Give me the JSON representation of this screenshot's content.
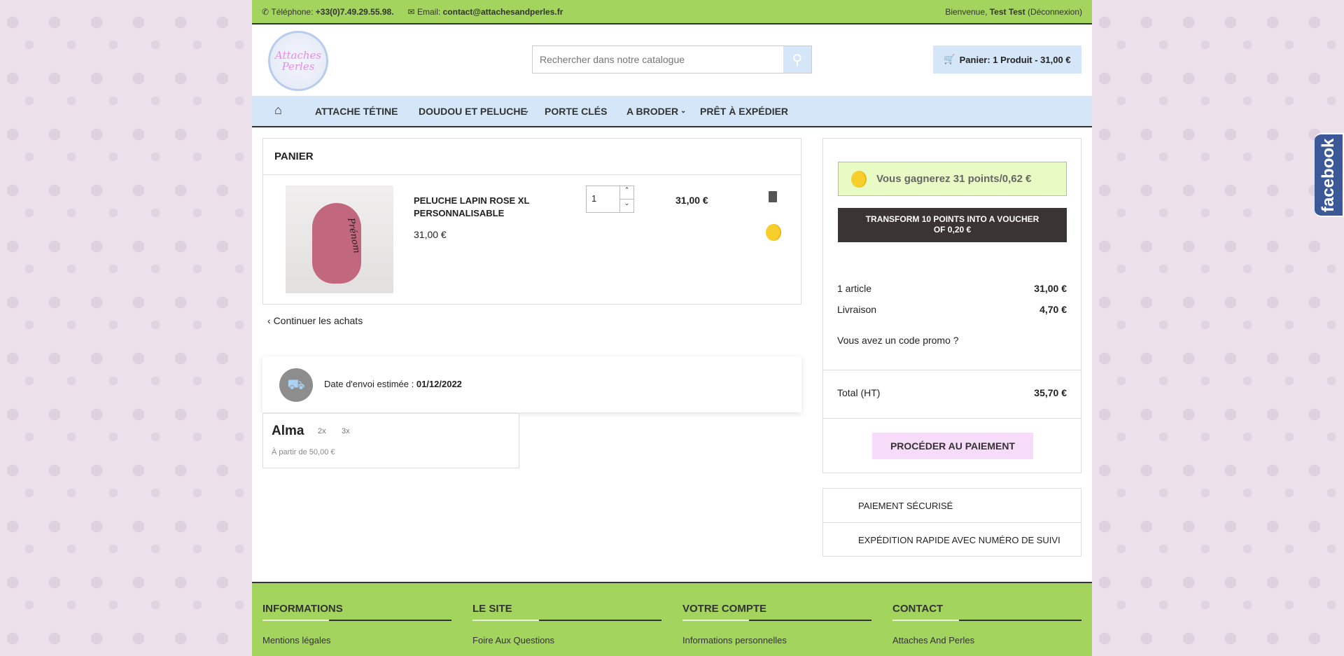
{
  "topbar": {
    "phone_label": "Téléphone:",
    "phone": "+33(0)7.49.29.55.98.",
    "email_label": "Email:",
    "email": "contact@attachesandperles.fr",
    "welcome": "Bienvenue,",
    "user": "Test Test",
    "logout": "(Déconnexion)"
  },
  "header": {
    "logo_text": "Attaches Perles",
    "search_placeholder": "Rechercher dans notre catalogue",
    "cart": "Panier: 1 Produit - 31,00 €"
  },
  "nav": [
    "ATTACHE TÉTINE",
    "DOUDOU ET PELUCHE",
    "PORTE CLÉS",
    "A BRODER",
    "PRÊT À EXPÉDIER"
  ],
  "cart": {
    "title": "PANIER",
    "item": {
      "name": "PELUCHE LAPIN ROSE XL PERSONNALISABLE",
      "unit_price": "31,00 €",
      "qty": "1",
      "total": "31,00 €",
      "embroidery": "Prénom"
    },
    "continue": "Continuer les achats"
  },
  "delivery": {
    "label": "Date d'envoi estimée :",
    "date": "01/12/2022"
  },
  "alma": {
    "name": "Alma",
    "options": [
      "2x",
      "3x"
    ],
    "note": "À partir de 50,00 €"
  },
  "summary": {
    "points": "Vous gagnerez 31 points/0,62 €",
    "transform": "TRANSFORM 10 POINTS INTO A VOUCHER OF 0,20 €",
    "articles_label": "1 article",
    "articles_value": "31,00 €",
    "shipping_label": "Livraison",
    "shipping_value": "4,70 €",
    "promo": "Vous avez un code promo ?",
    "total_label": "Total (HT)",
    "total_value": "35,70 €",
    "checkout": "PROCÉDER AU PAIEMENT"
  },
  "reassurance": [
    "PAIEMENT SÉCURISÉ",
    "EXPÉDITION RAPIDE AVEC NUMÉRO DE SUIVI"
  ],
  "footer": [
    {
      "title": "INFORMATIONS",
      "link": "Mentions légales"
    },
    {
      "title": "LE SITE",
      "link": "Foire Aux Questions"
    },
    {
      "title": "VOTRE COMPTE",
      "link": "Informations personnelles"
    },
    {
      "title": "CONTACT",
      "link": "Attaches And Perles"
    }
  ],
  "facebook": "facebook"
}
